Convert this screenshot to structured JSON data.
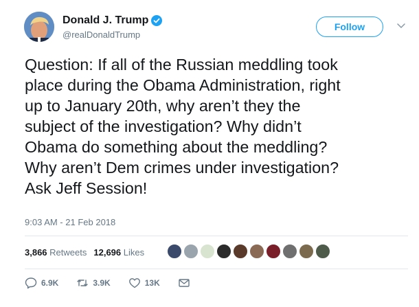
{
  "user": {
    "display_name": "Donald J. Trump",
    "handle": "@realDonaldTrump",
    "verified": true
  },
  "follow_label": "Follow",
  "tweet": {
    "text": "Question: If all of the Russian meddling took\nplace during the Obama Administration, right\nup to January 20th, why aren’t they the\nsubject of the investigation? Why didn’t\nObama do something about the meddling?\nWhy aren’t Dem crimes under investigation?\nAsk Jeff Session!",
    "timestamp": "9:03 AM - 21 Feb 2018"
  },
  "stats": {
    "retweets_count": "3,866",
    "retweets_label": "Retweets",
    "likes_count": "12,696",
    "likes_label": "Likes"
  },
  "likers": [
    {
      "color": "#3b4a6b"
    },
    {
      "color": "#9aa4ad"
    },
    {
      "color": "#d8e4d0"
    },
    {
      "color": "#2b2b2b"
    },
    {
      "color": "#5a3a2a"
    },
    {
      "color": "#8a6a55"
    },
    {
      "color": "#7a1f2a"
    },
    {
      "color": "#6f6f6f"
    },
    {
      "color": "#7b6a4e"
    },
    {
      "color": "#4e5a4a"
    }
  ],
  "actions": {
    "replies": "6.9K",
    "retweets": "3.9K",
    "likes": "13K"
  },
  "colors": {
    "accent": "#1da1f2",
    "secondary_text": "#657786",
    "primary_text": "#14171a"
  }
}
